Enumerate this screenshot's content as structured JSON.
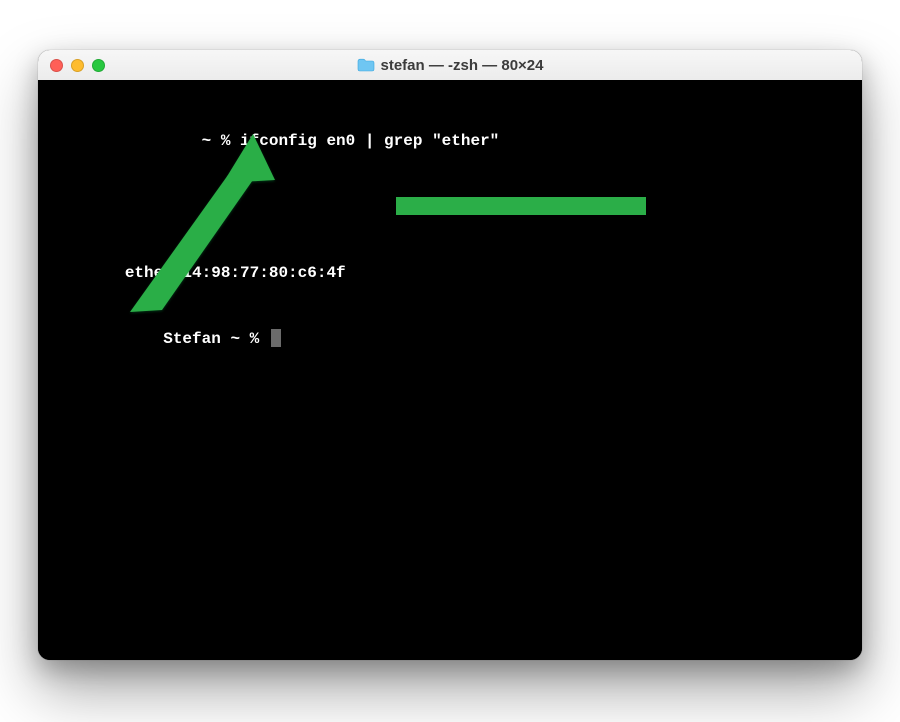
{
  "window": {
    "title": "stefan — -zsh — 80×24"
  },
  "terminal": {
    "line1_indent": "                ",
    "line1_prompt": "~ % ",
    "line1_command": "ifconfig en0 | grep \"ether\"",
    "line2_indent": "        ",
    "line2_output": "ether 14:98:77:80:c6:4f",
    "line3_indent": "            ",
    "line3_user": "Stefan ",
    "line3_prompt": "~ % "
  }
}
